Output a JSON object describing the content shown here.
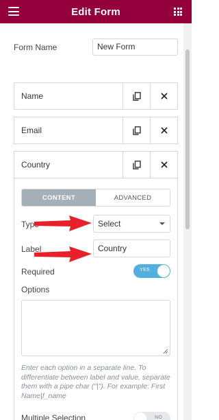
{
  "header": {
    "title": "Edit Form",
    "menu_icon": "hamburger-icon",
    "apps_icon": "grid-icon",
    "background": "#93003c"
  },
  "form_name": {
    "label": "Form Name",
    "value": "New Form"
  },
  "fields": [
    {
      "label": "Name"
    },
    {
      "label": "Email"
    },
    {
      "label": "Country"
    }
  ],
  "tabs": {
    "content": "CONTENT",
    "advanced": "ADVANCED",
    "active": "content"
  },
  "field_settings": {
    "type_label": "Type",
    "type_value": "Select",
    "label_label": "Label",
    "label_value": "Country",
    "required_label": "Required",
    "required_toggle": "YES",
    "options_label": "Options",
    "options_value": "",
    "help_text": "Enter each option in a separate line. To differentiate between label and value, separate them with a pipe char (\"|\"). For example: First Name|f_name",
    "multiple_label": "Multiple Selection",
    "multiple_toggle": "NO"
  },
  "colors": {
    "accent": "#93003c",
    "toggle_on": "#53b0de",
    "tab_active": "#a4afb7",
    "annotation_arrow": "#e8202a"
  }
}
